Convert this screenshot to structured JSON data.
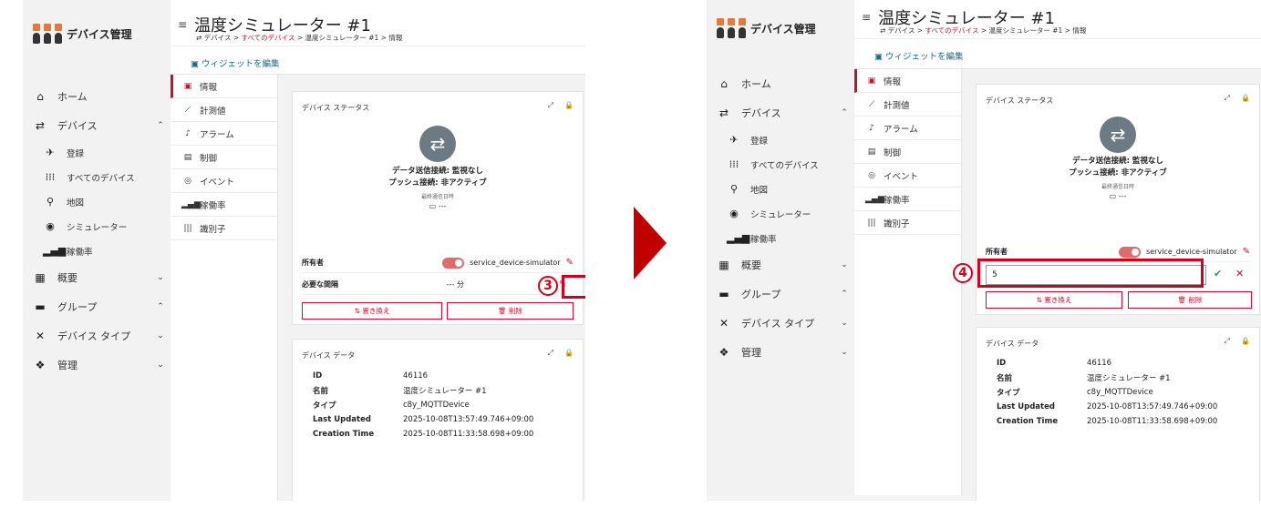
{
  "app": {
    "name": "デバイス管理"
  },
  "nav": {
    "home": "ホーム",
    "devices": "デバイス",
    "devices_sub": [
      "登録",
      "すべてのデバイス",
      "地図",
      "シミュレーター",
      "稼働率"
    ],
    "overview": "概要",
    "groups": "グループ",
    "device_types": "デバイス タイプ",
    "management": "管理"
  },
  "header": {
    "title": "温度シミュレーター #1",
    "breadcrumb": {
      "prefix": "⇄ デバイス > ",
      "link": "すべてのデバイス",
      "suffix": " > 温度シミュレーター #1 > 情報"
    },
    "edit_widgets": "ウィジェットを編集"
  },
  "tabs": [
    "情報",
    "計測値",
    "アラーム",
    "制御",
    "イベント",
    "稼働率",
    "識別子"
  ],
  "status_card": {
    "title": "デバイス ステータス",
    "send_status": "データ送信接続: 監視なし",
    "push_status": "プッシュ接続: 非アクティブ",
    "last_comm_label": "最終通信日時",
    "last_comm_value": "---"
  },
  "properties": {
    "owner_label": "所有者",
    "owner_value": "service_device-simulator",
    "interval_label": "必要な間隔",
    "interval_value": "--- 分",
    "interval_input": "5"
  },
  "buttons": {
    "replace": "置き換え",
    "delete": "削除"
  },
  "device_data": {
    "title": "デバイス データ",
    "rows": [
      {
        "key": "ID",
        "value": "46116"
      },
      {
        "key": "名前",
        "value": "温度シミュレーター #1"
      },
      {
        "key": "タイプ",
        "value": "c8y_MQTTDevice"
      },
      {
        "key": "Last Updated",
        "value": "2025-10-08T13:57:49.746+09:00"
      },
      {
        "key": "Creation Time",
        "value": "2025-10-08T11:33:58.698+09:00"
      }
    ]
  },
  "callouts": {
    "step3": "3",
    "step4": "4"
  },
  "icons": {
    "accent": "#c8102e",
    "callout": "#d0021b",
    "arrow": "#c00000"
  }
}
